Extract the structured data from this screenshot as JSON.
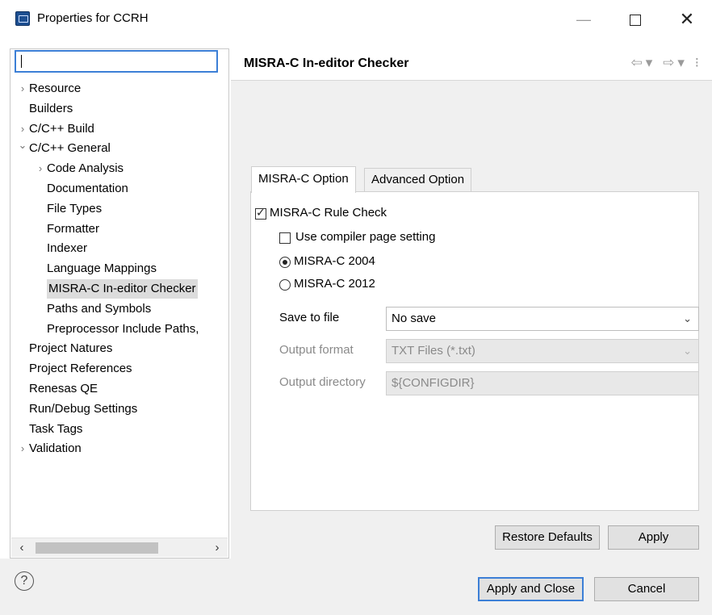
{
  "window": {
    "title": "Properties for CCRH",
    "minimize_glyph": "—",
    "close_glyph": "✕"
  },
  "filter": {
    "value": "",
    "placeholder": ""
  },
  "tree": [
    {
      "label": "Resource",
      "arrow": "›"
    },
    {
      "label": "Builders",
      "arrow": ""
    },
    {
      "label": "C/C++ Build",
      "arrow": "›"
    },
    {
      "label": "C/C++ General",
      "arrow": "⌄"
    },
    {
      "label": "Code Analysis",
      "arrow": "›"
    },
    {
      "label": "Documentation",
      "arrow": ""
    },
    {
      "label": "File Types",
      "arrow": ""
    },
    {
      "label": "Formatter",
      "arrow": ""
    },
    {
      "label": "Indexer",
      "arrow": ""
    },
    {
      "label": "Language Mappings",
      "arrow": ""
    },
    {
      "label": "MISRA-C In-editor Checker",
      "arrow": ""
    },
    {
      "label": "Paths and Symbols",
      "arrow": ""
    },
    {
      "label": "Preprocessor Include Paths,",
      "arrow": ""
    },
    {
      "label": "Project Natures",
      "arrow": ""
    },
    {
      "label": "Project References",
      "arrow": ""
    },
    {
      "label": "Renesas QE",
      "arrow": ""
    },
    {
      "label": "Run/Debug Settings",
      "arrow": ""
    },
    {
      "label": "Task Tags",
      "arrow": ""
    },
    {
      "label": "Validation",
      "arrow": "›"
    }
  ],
  "scroll": {
    "left": "‹",
    "right": "›"
  },
  "page": {
    "title": "MISRA-C In-editor Checker",
    "nav": {
      "back": "⇦",
      "dropdown": "▾",
      "forward": "⇨",
      "menu": "⁝"
    }
  },
  "tabs": [
    {
      "label": "MISRA-C Option",
      "active": true
    },
    {
      "label": "Advanced Option",
      "active": false
    }
  ],
  "options": {
    "rule_check": {
      "label": "MISRA-C Rule Check",
      "checked": true
    },
    "use_compiler": {
      "label": "Use compiler page setting",
      "checked": false
    },
    "misra_2004": {
      "label": "MISRA-C 2004",
      "selected": true
    },
    "misra_2012": {
      "label": "MISRA-C 2012",
      "selected": false
    },
    "save_to_file": {
      "label": "Save to file",
      "value": "No save"
    },
    "output_format": {
      "label": "Output format",
      "value": "TXT Files (*.txt)"
    },
    "output_directory": {
      "label": "Output directory",
      "value": "${CONFIGDIR}"
    }
  },
  "buttons": {
    "restore_defaults": "Restore Defaults",
    "apply": "Apply",
    "apply_and_close": "Apply and Close",
    "cancel": "Cancel"
  },
  "help": {
    "glyph": "?"
  },
  "colors": {
    "focus_border": "#3c7fd6",
    "selection_bg": "#dcdcdc",
    "panel_bg": "#f0f0f0"
  }
}
